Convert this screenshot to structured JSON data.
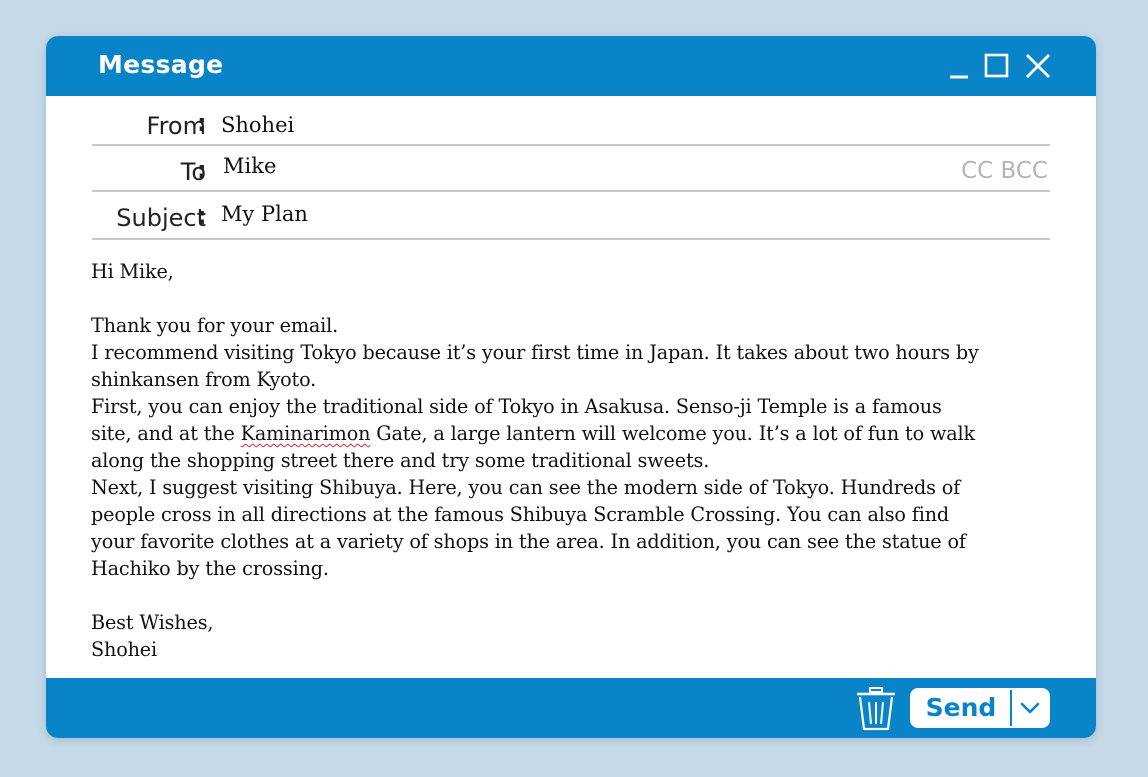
{
  "window": {
    "title": "Message"
  },
  "header": {
    "from_label": "From",
    "from_value": "Shohei",
    "to_label": "To",
    "to_value": "Mike",
    "subject_label": "Subject",
    "subject_value": "My Plan",
    "colon": ":",
    "cc_label": "CC",
    "bcc_label": "BCC"
  },
  "body": {
    "greeting": "Hi Mike,",
    "lines": [
      "Thank you for your email.",
      "I recommend visiting Tokyo because it’s your first time in Japan. It takes about two hours by",
      "shinkansen from Kyoto.",
      "First, you can enjoy the traditional side of Tokyo in Asakusa. Senso-ji Temple is a famous",
      "site, and at the ",
      "Kaminarimon",
      " Gate, a large lantern will welcome you. It’s a lot of fun to walk",
      "along the shopping street there and try some traditional sweets.",
      "Next, I suggest visiting Shibuya. Here, you can see the modern side of Tokyo. Hundreds of",
      "people cross in all directions at the famous Shibuya Scramble Crossing. You can also find",
      "your favorite clothes at a variety of shops in the area. In addition, you can see the statue of",
      "Hachiko by the crossing."
    ],
    "closing": "Best Wishes,",
    "signature": "Shohei"
  },
  "footer": {
    "send_label": "Send"
  },
  "icons": {
    "minimize": "minimize-icon",
    "maximize": "maximize-icon",
    "close": "close-icon",
    "trash": "trash-icon",
    "dropdown": "chevron-down-icon"
  },
  "colors": {
    "accent": "#0a84c8",
    "background": "#c6d9e9",
    "spellcheck": "#d4282f",
    "muted": "#b5b5b5"
  }
}
